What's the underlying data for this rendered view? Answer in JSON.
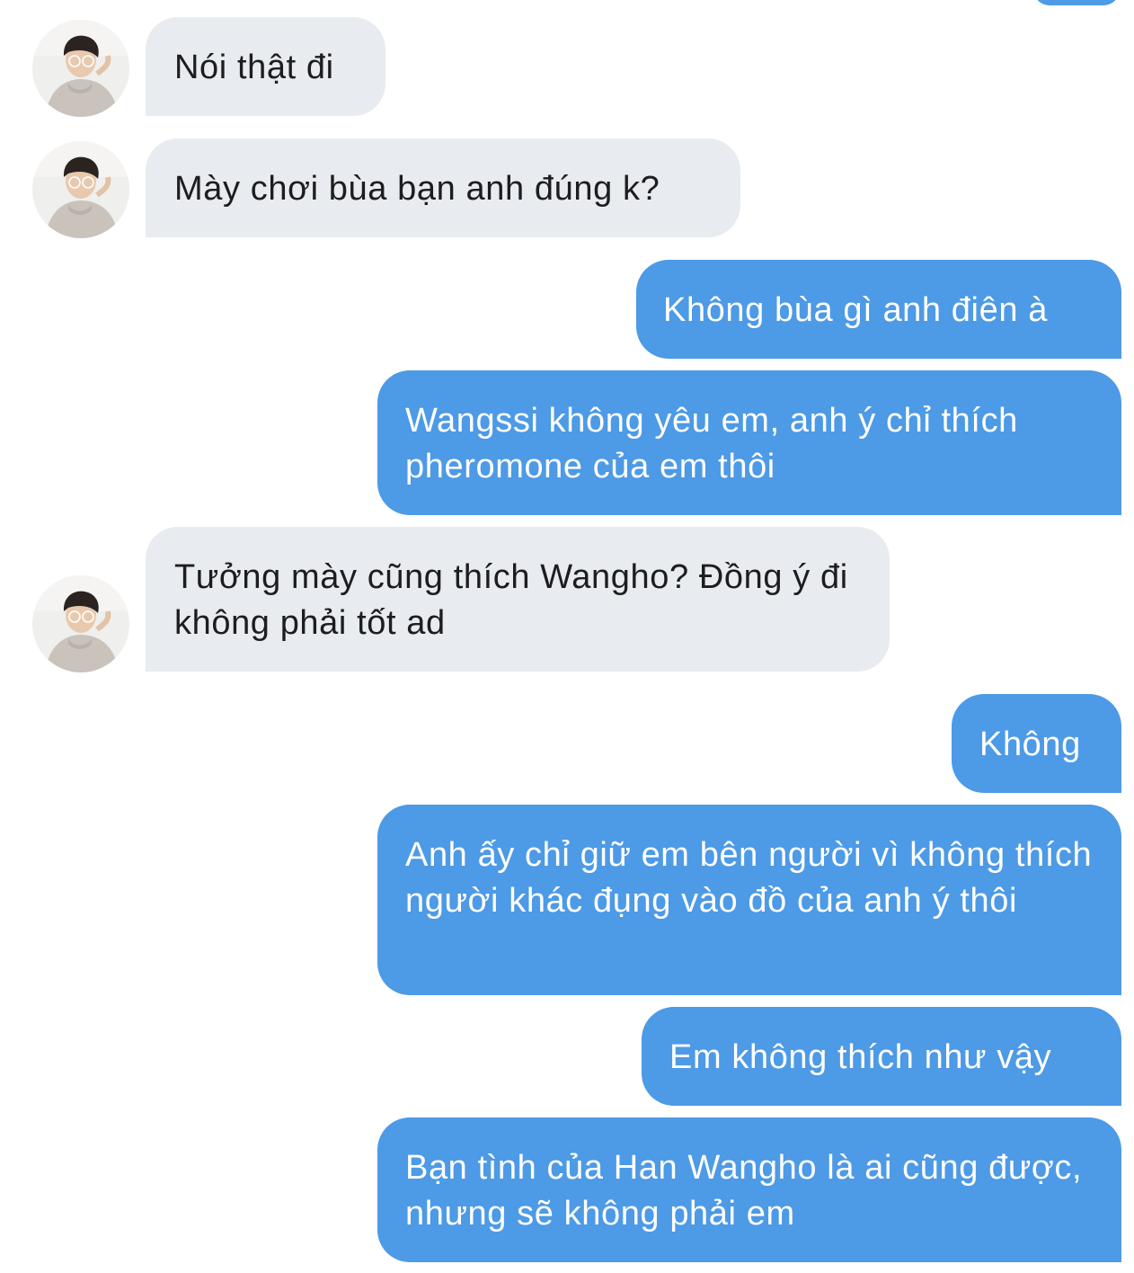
{
  "conversation": {
    "messages": [
      {
        "from": "them",
        "text": "Nói thật đi"
      },
      {
        "from": "them",
        "text": "Mày chơi bùa bạn anh đúng k?"
      },
      {
        "from": "me",
        "text": "Không bùa gì anh điên à"
      },
      {
        "from": "me",
        "text": "Wangssi không yêu em, anh ý chỉ thích pheromone của em thôi"
      },
      {
        "from": "them",
        "text": "Tưởng mày cũng thích Wangho? Đồng ý đi không phải tốt ad"
      },
      {
        "from": "me",
        "text": "Không"
      },
      {
        "from": "me",
        "text": "Anh ấy chỉ giữ em bên người vì không thích người khác đụng vào đồ của anh ý thôi"
      },
      {
        "from": "me",
        "text": "Em không thích như vậy"
      },
      {
        "from": "me",
        "text": "Bạn tình của Han Wangho là ai cũng được, nhưng sẽ không phải em"
      }
    ]
  },
  "colors": {
    "incoming_bubble": "#e8ebef",
    "outgoing_bubble": "#4d9ae6",
    "incoming_text": "#1d1d1f",
    "outgoing_text": "#ffffff"
  }
}
